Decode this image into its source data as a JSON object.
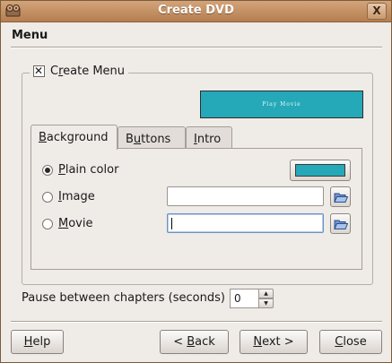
{
  "window": {
    "title": "Create DVD",
    "app_icon": "film-reel-icon",
    "close_label": "X"
  },
  "section": {
    "title": "Menu"
  },
  "create_menu": {
    "checked": true,
    "label_pre": "C",
    "label_mnemonic": "r",
    "label_post": "eate Menu"
  },
  "preview": {
    "text": "Play Movie",
    "background_color": "#25a9b8"
  },
  "tabs": [
    {
      "pre": "",
      "mnemonic": "B",
      "post": "ackground",
      "active": true
    },
    {
      "pre": "B",
      "mnemonic": "u",
      "post": "ttons",
      "active": false
    },
    {
      "pre": "",
      "mnemonic": "I",
      "post": "ntro",
      "active": false
    }
  ],
  "background_options": [
    {
      "pre": "",
      "mnemonic": "P",
      "post": "lain color",
      "selected": true
    },
    {
      "pre": "",
      "mnemonic": "I",
      "post": "mage",
      "selected": false
    },
    {
      "pre": "",
      "mnemonic": "M",
      "post": "ovie",
      "selected": false
    }
  ],
  "fields": {
    "image_value": "",
    "movie_value": "",
    "plain_color": "#25a9b8",
    "browse_icon": "folder-open-icon"
  },
  "pause": {
    "label": "Pause between chapters (seconds)",
    "value": "0",
    "up_arrow": "▲",
    "down_arrow": "▼"
  },
  "buttons": {
    "help": {
      "pre": "",
      "mnemonic": "H",
      "post": "elp"
    },
    "back": {
      "pre": "< ",
      "mnemonic": "B",
      "post": "ack"
    },
    "next": {
      "pre": "",
      "mnemonic": "N",
      "post": "ext >"
    },
    "close": {
      "pre": "",
      "mnemonic": "C",
      "post": "lose"
    }
  }
}
